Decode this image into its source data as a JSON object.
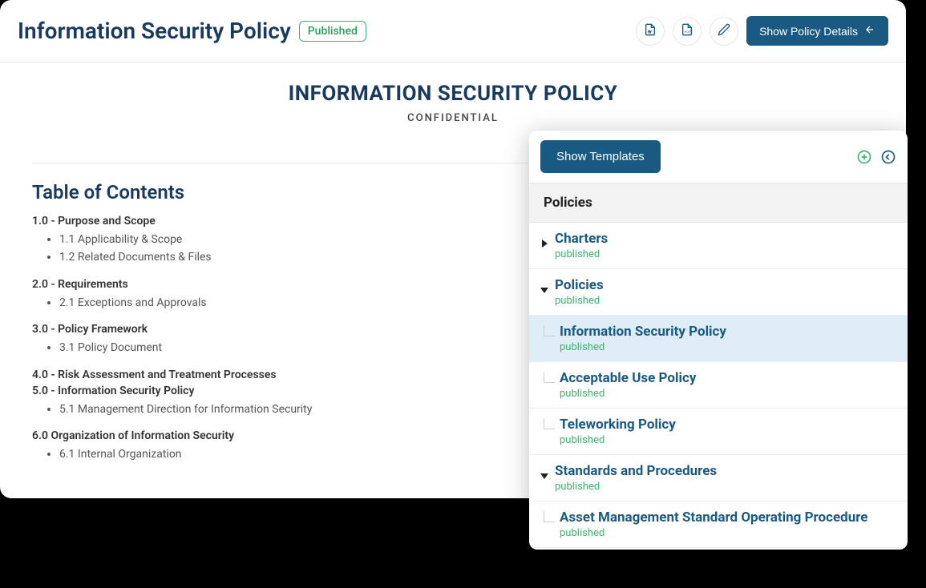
{
  "header": {
    "title": "Information Security Policy",
    "status": "Published",
    "showDetails": "Show Policy Details"
  },
  "doc": {
    "title": "INFORMATION SECURITY POLICY",
    "subtitle": "CONFIDENTIAL",
    "tocTitle": "Table of Contents",
    "sections": [
      {
        "head": "1.0 - Purpose and Scope",
        "subs": [
          "1.1 Applicability & Scope",
          "1.2 Related Documents & Files"
        ]
      },
      {
        "head": "2.0 - Requirements",
        "subs": [
          "2.1 Exceptions and Approvals"
        ]
      },
      {
        "head": "3.0 - Policy Framework",
        "subs": [
          "3.1 Policy Document"
        ]
      },
      {
        "head": "4.0 - Risk Assessment and Treatment Processes",
        "subs": []
      },
      {
        "head": "5.0 - Information Security Policy",
        "subs": [
          "5.1 Management Direction for Information Security"
        ]
      },
      {
        "head": "6.0 Organization of Information Security",
        "subs": [
          "6.1 Internal Organization"
        ]
      }
    ]
  },
  "panel": {
    "showTemplates": "Show Templates",
    "heading": "Policies",
    "tree": [
      {
        "title": "Charters",
        "status": "published",
        "caret": "right",
        "indent": 0,
        "selected": false
      },
      {
        "title": "Policies",
        "status": "published",
        "caret": "down",
        "indent": 0,
        "selected": false
      },
      {
        "title": "Information Security Policy",
        "status": "published",
        "caret": "none",
        "indent": 1,
        "selected": true
      },
      {
        "title": "Acceptable Use Policy",
        "status": "published",
        "caret": "none",
        "indent": 1,
        "selected": false
      },
      {
        "title": "Teleworking Policy",
        "status": "published",
        "caret": "none",
        "indent": 1,
        "selected": false
      },
      {
        "title": "Standards and Procedures",
        "status": "published",
        "caret": "down",
        "indent": 0,
        "selected": false
      },
      {
        "title": "Asset Management Standard Operating Procedure",
        "status": "published",
        "caret": "none",
        "indent": 1,
        "selected": false
      }
    ]
  }
}
